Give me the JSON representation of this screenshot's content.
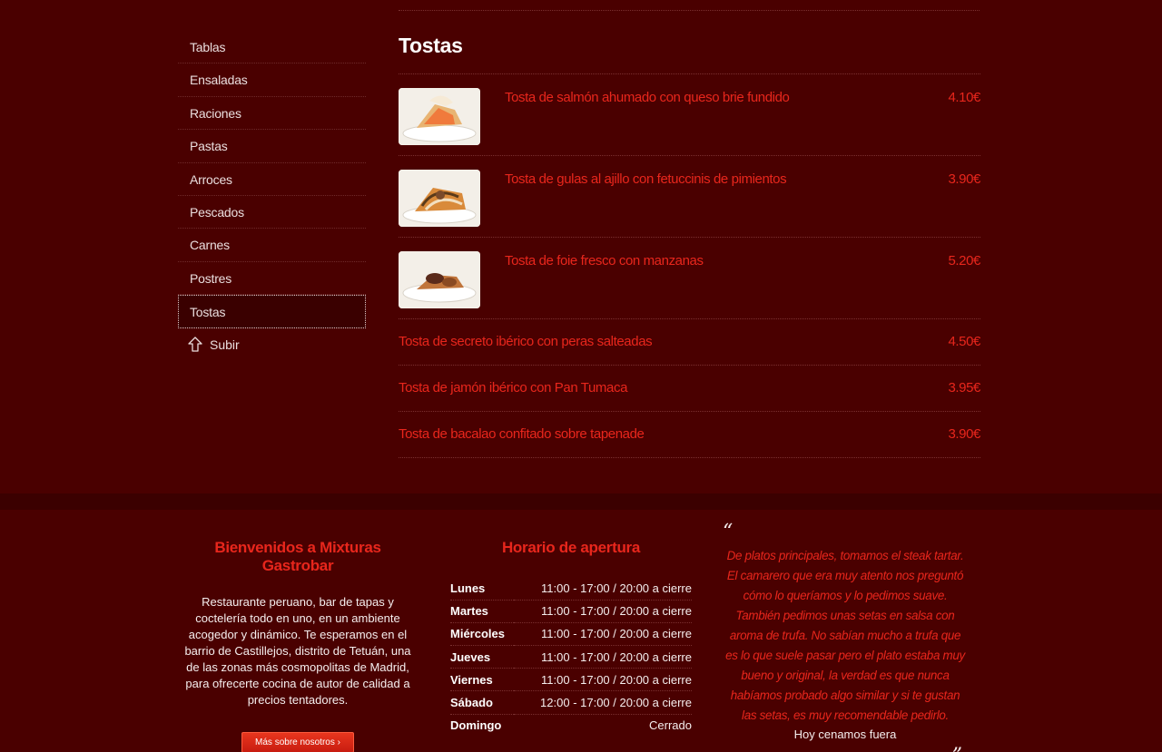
{
  "sidebar": {
    "items": [
      {
        "label": "Tablas"
      },
      {
        "label": "Ensaladas"
      },
      {
        "label": "Raciones"
      },
      {
        "label": "Pastas"
      },
      {
        "label": "Arroces"
      },
      {
        "label": "Pescados"
      },
      {
        "label": "Carnes"
      },
      {
        "label": "Postres"
      },
      {
        "label": "Tostas"
      }
    ],
    "active": "Tostas",
    "up_label": "Subir"
  },
  "section": {
    "title": "Tostas",
    "dishes_with_image": [
      {
        "name": "Tosta de salmón ahumado con queso brie fundido",
        "price": "4.10€"
      },
      {
        "name": "Tosta de gulas al ajillo con fetuccinis de pimientos",
        "price": "3.90€"
      },
      {
        "name": "Tosta de foie fresco con manzanas",
        "price": "5.20€"
      }
    ],
    "dishes": [
      {
        "name": "Tosta de secreto ibérico con peras salteadas",
        "price": "4.50€"
      },
      {
        "name": "Tosta de jamón ibérico con Pan Tumaca",
        "price": "3.95€"
      },
      {
        "name": "Tosta de bacalao confitado sobre tapenade",
        "price": "3.90€"
      }
    ]
  },
  "footer": {
    "welcome": {
      "title": "Bienvenidos a Mixturas Gastrobar",
      "text": "Restaurante peruano, bar de tapas y coctelería todo en uno, en un ambiente acogedor y dinámico. Te esperamos en el barrio de Castillejos, distrito de Tetuán, una de las zonas más cosmopolitas de Madrid, para ofrecerte cocina de autor de calidad a precios tentadores.",
      "button": "Más sobre nosotros ›"
    },
    "hours": {
      "title": "Horario de apertura",
      "rows": [
        {
          "day": "Lunes",
          "time": "11:00 - 17:00 / 20:00 a cierre"
        },
        {
          "day": "Martes",
          "time": "11:00 - 17:00 / 20:00 a cierre"
        },
        {
          "day": "Miércoles",
          "time": "11:00 - 17:00 / 20:00 a cierre"
        },
        {
          "day": "Jueves",
          "time": "11:00 - 17:00 / 20:00 a cierre"
        },
        {
          "day": "Viernes",
          "time": "11:00 - 17:00 / 20:00 a cierre"
        },
        {
          "day": "Sábado",
          "time": "12:00 - 17:00 / 20:00 a cierre"
        },
        {
          "day": "Domingo",
          "time": "Cerrado"
        }
      ]
    },
    "review": {
      "open_quote": "“",
      "text": "De platos principales, tomamos el steak tartar. El camarero que era muy atento nos preguntó cómo lo queríamos y lo pedimos suave. También pedimos unas setas en salsa con aroma de trufa. No sabían mucho a trufa que es lo que suele pasar pero el plato estaba muy bueno y original, la verdad es que nunca habíamos probado algo similar y si te gustan las setas, es muy recomendable pedirlo.",
      "author": "Hoy cenamos fuera",
      "close_quote": "”"
    }
  },
  "colors": {
    "background": "#4a0000",
    "accent": "#e8261c",
    "footer_band": "#3b0000"
  }
}
